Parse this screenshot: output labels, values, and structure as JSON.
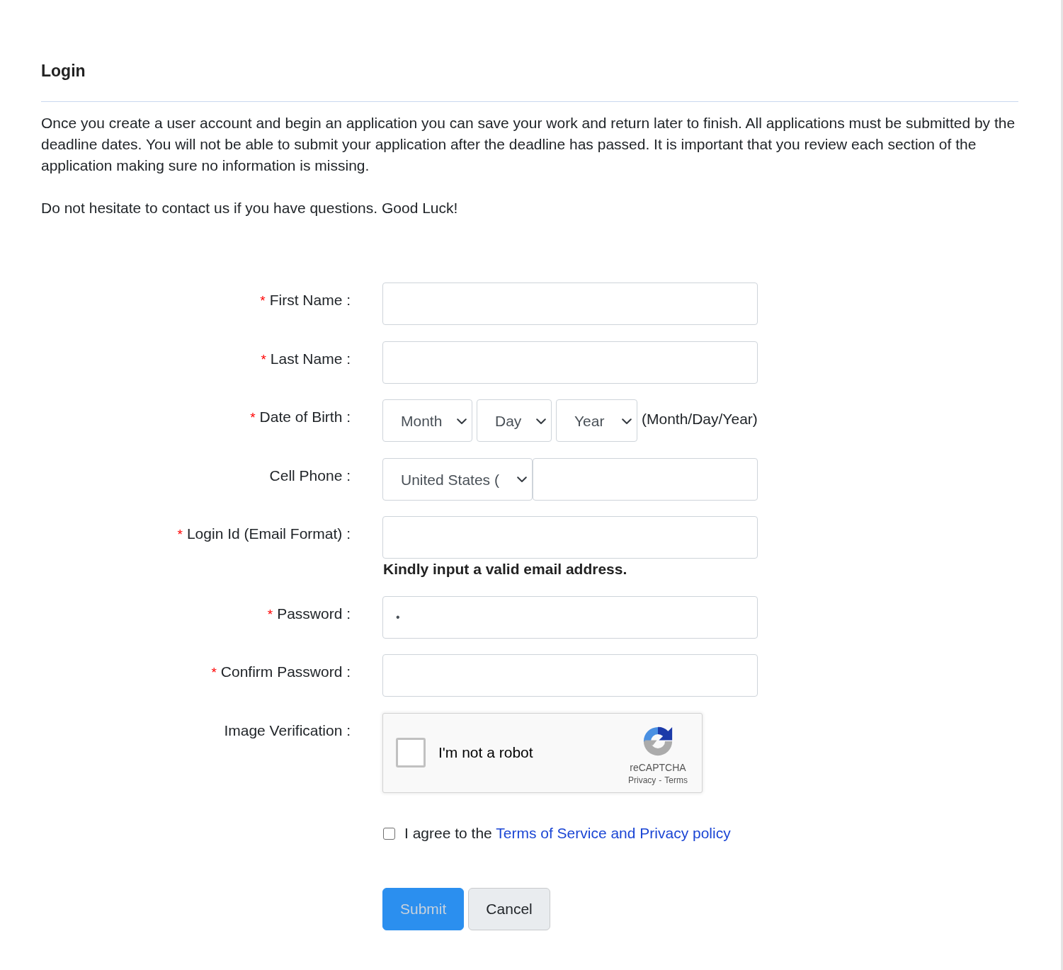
{
  "page": {
    "title": "Login"
  },
  "intro": [
    "Once you create a user account and begin an application you can save your work and return later to finish. All applications must be submitted by the deadline dates. You will not be able to submit your application after the deadline has passed. It is important that you review each section of the application making sure no information is missing.",
    "Do not hesitate to contact us if you have questions. Good Luck!"
  ],
  "form": {
    "required_marker": "*",
    "fields": [
      {
        "kind": "text",
        "label": "First Name :",
        "required": true
      },
      {
        "kind": "text",
        "label": "Last Name :",
        "required": true
      },
      {
        "kind": "date",
        "label": "Date of Birth :",
        "required": true,
        "selects": [
          "Month",
          "Day",
          "Year"
        ],
        "hint": "(Month/Day/Year)"
      },
      {
        "kind": "phone",
        "label": "Cell Phone :",
        "required": false,
        "country": "United States ("
      },
      {
        "kind": "text",
        "label": "Login Id (Email Format) :",
        "required": true,
        "message": "Kindly input a valid email address."
      },
      {
        "kind": "text",
        "label": "Password :",
        "required": true,
        "value": "•"
      },
      {
        "kind": "text",
        "label": "Confirm Password :",
        "required": true
      },
      {
        "kind": "captcha",
        "label": "Image Verification :",
        "required": false,
        "checkbox_label": "I'm not a robot",
        "checked": false,
        "brand": "reCAPTCHA",
        "links": [
          "Privacy",
          "Terms"
        ],
        "separator": "-"
      }
    ]
  },
  "agreement": {
    "checked": false,
    "text": "I agree to the",
    "link": "Terms of Service and Privacy policy"
  },
  "buttons": [
    {
      "label": "Submit",
      "kind": "primary",
      "disabled": true
    },
    {
      "label": "Cancel",
      "kind": "secondary",
      "disabled": false
    }
  ]
}
